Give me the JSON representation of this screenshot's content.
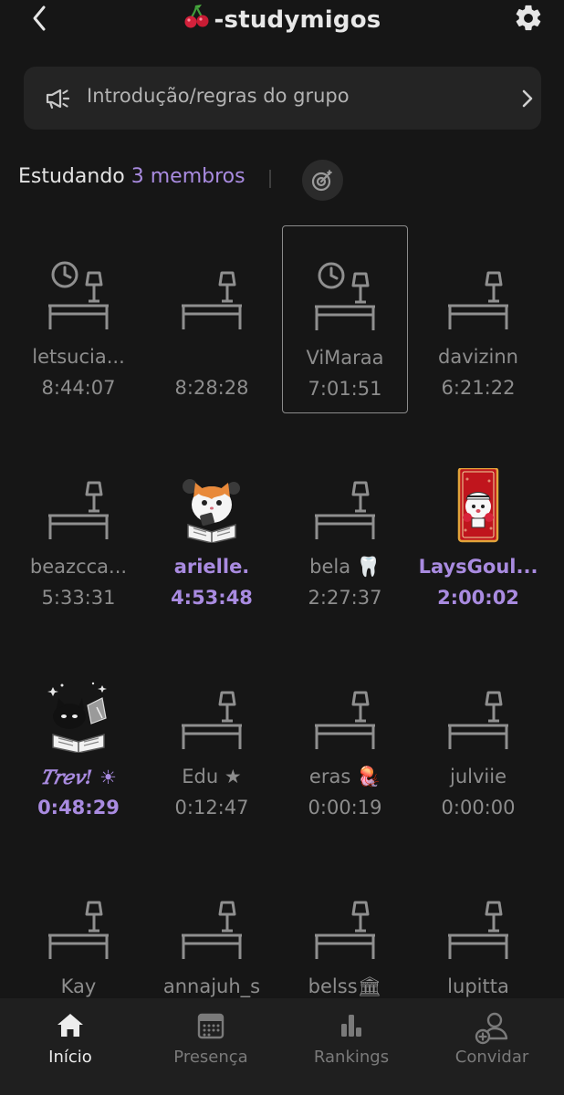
{
  "header": {
    "title": "-studymigos",
    "icons": {
      "back": "chevron-left-icon",
      "title_emoji": "cherry-icon",
      "settings": "gear-icon"
    }
  },
  "rules_bar": {
    "label": "Introdução/regras do grupo",
    "icon": "megaphone-icon"
  },
  "studying": {
    "label": "Estudando",
    "count": "3 membros"
  },
  "members": [
    {
      "name": "letsucia...",
      "time": "8:44:07",
      "avatar": "desk-clock"
    },
    {
      "name": "",
      "time": "8:28:28",
      "avatar": "desk"
    },
    {
      "name": "ViMaraa",
      "time": "7:01:51",
      "avatar": "desk-clock",
      "selected": true
    },
    {
      "name": "davizinn",
      "time": "6:21:22",
      "avatar": "desk"
    },
    {
      "name": "beazcca...",
      "time": "5:33:31",
      "avatar": "desk"
    },
    {
      "name": "arielle.",
      "time": "4:53:48",
      "avatar": "cat-reading",
      "active": true
    },
    {
      "name": "bela 🦷",
      "time": "2:27:37",
      "avatar": "desk"
    },
    {
      "name": "LaysGoul...",
      "time": "2:00:02",
      "avatar": "card-character",
      "active": true
    },
    {
      "name": "𝑇𝑟𝑒𝑣! ☀",
      "time": "0:48:29",
      "avatar": "cat-reading-dark",
      "active": true
    },
    {
      "name": "Edu ★",
      "time": "0:12:47",
      "avatar": "desk"
    },
    {
      "name": "eras 🪼",
      "time": "0:00:19",
      "avatar": "desk"
    },
    {
      "name": "julviie",
      "time": "0:00:00",
      "avatar": "desk"
    },
    {
      "name": "Kay",
      "time": "",
      "avatar": "desk"
    },
    {
      "name": "annajuh_s",
      "time": "",
      "avatar": "desk"
    },
    {
      "name": "belss🏛",
      "time": "",
      "avatar": "desk"
    },
    {
      "name": "lupitta",
      "time": "",
      "avatar": "desk"
    }
  ],
  "nav": [
    {
      "label": "Início",
      "icon": "home-icon",
      "current": true
    },
    {
      "label": "Presença",
      "icon": "calendar-icon"
    },
    {
      "label": "Rankings",
      "icon": "bar-chart-icon"
    },
    {
      "label": "Convidar",
      "icon": "add-user-icon"
    }
  ],
  "colors": {
    "accent": "#a98be0",
    "background": "#161616",
    "surface": "#242424",
    "muted": "#8d8d8d"
  }
}
